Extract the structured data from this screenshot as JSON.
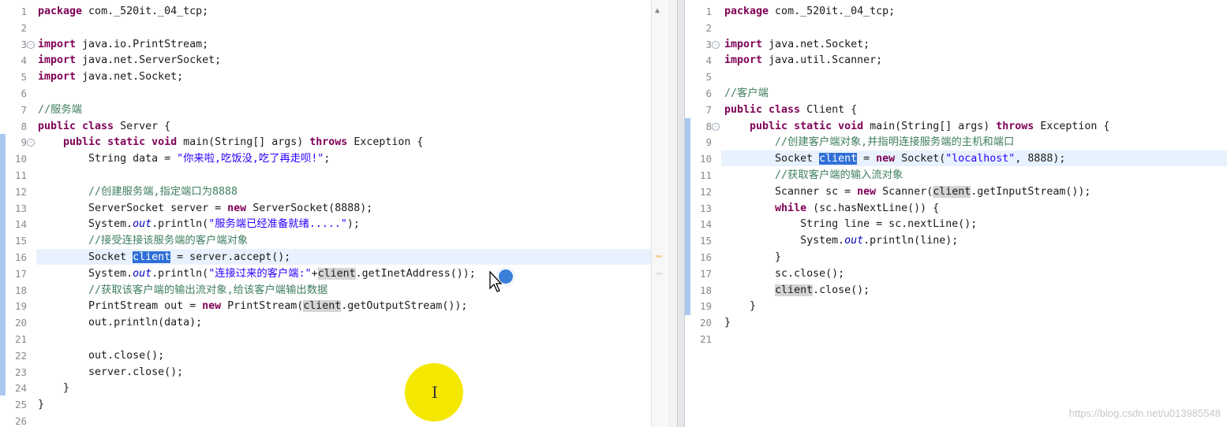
{
  "left_editor": {
    "lines": [
      {
        "n": "1"
      },
      {
        "n": "2"
      },
      {
        "n": "3"
      },
      {
        "n": "4"
      },
      {
        "n": "5"
      },
      {
        "n": "6"
      },
      {
        "n": "7"
      },
      {
        "n": "8"
      },
      {
        "n": "9"
      },
      {
        "n": "10"
      },
      {
        "n": "11"
      },
      {
        "n": "12"
      },
      {
        "n": "13"
      },
      {
        "n": "14"
      },
      {
        "n": "15"
      },
      {
        "n": "16"
      },
      {
        "n": "17"
      },
      {
        "n": "18"
      },
      {
        "n": "19"
      },
      {
        "n": "20"
      },
      {
        "n": "21"
      },
      {
        "n": "22"
      },
      {
        "n": "23"
      },
      {
        "n": "24"
      },
      {
        "n": "25"
      },
      {
        "n": "26"
      }
    ],
    "code": {
      "l1_kw": "package",
      "l1_rest": " com._520it._04_tcp;",
      "l3_kw": "import",
      "l3_rest": " java.io.PrintStream;",
      "l4_kw": "import",
      "l4_rest": " java.net.ServerSocket;",
      "l5_kw": "import",
      "l5_rest": " java.net.Socket;",
      "l7_cmt": "//服务端",
      "l8_kw": "public class",
      "l8_rest": " Server {",
      "l9_indent": "    ",
      "l9_kw": "public static void",
      "l9_mid": " main(String[] args) ",
      "l9_kw2": "throws",
      "l9_rest": " Exception {",
      "l10_pre": "        String data = ",
      "l10_str": "\"你来啦,吃饭没,吃了再走呗!\"",
      "l10_post": ";",
      "l12_cmt": "        //创建服务端,指定端口为8888",
      "l13_pre": "        ServerSocket server = ",
      "l13_kw": "new",
      "l13_post": " ServerSocket(8888);",
      "l14_pre": "        System.",
      "l14_fld": "out",
      "l14_mid": ".println(",
      "l14_str": "\"服务端已经准备就绪.....\"",
      "l14_post": ");",
      "l15_cmt": "        //接受连接该服务端的客户端对象",
      "l16_pre": "        Socket ",
      "l16_sel": "client",
      "l16_post": " = server.accept();",
      "l17_pre": "        System.",
      "l17_fld": "out",
      "l17_mid": ".println(",
      "l17_str": "\"连接过来的客户端:\"",
      "l17_plus": "+",
      "l17_occ": "client",
      "l17_post": ".getInetAddress());",
      "l18_cmt": "        //获取该客户端的输出流对象,给该客户端输出数据",
      "l19_pre": "        PrintStream out = ",
      "l19_kw": "new",
      "l19_mid": " PrintStream(",
      "l19_occ": "client",
      "l19_post": ".getOutputStream());",
      "l20": "        out.println(data);",
      "l22": "        out.close();",
      "l23": "        server.close();",
      "l24": "    }",
      "l25": "}"
    }
  },
  "right_editor": {
    "lines": [
      {
        "n": "1"
      },
      {
        "n": "2"
      },
      {
        "n": "3"
      },
      {
        "n": "4"
      },
      {
        "n": "5"
      },
      {
        "n": "6"
      },
      {
        "n": "7"
      },
      {
        "n": "8"
      },
      {
        "n": "9"
      },
      {
        "n": "10"
      },
      {
        "n": "11"
      },
      {
        "n": "12"
      },
      {
        "n": "13"
      },
      {
        "n": "14"
      },
      {
        "n": "15"
      },
      {
        "n": "16"
      },
      {
        "n": "17"
      },
      {
        "n": "18"
      },
      {
        "n": "19"
      },
      {
        "n": "20"
      },
      {
        "n": "21"
      }
    ],
    "code": {
      "r1_kw": "package",
      "r1_rest": " com._520it._04_tcp;",
      "r3_kw": "import",
      "r3_rest": " java.net.Socket;",
      "r4_kw": "import",
      "r4_rest": " java.util.Scanner;",
      "r6_cmt": "//客户端",
      "r7_kw": "public class",
      "r7_rest": " Client {",
      "r8_indent": "    ",
      "r8_kw": "public static void",
      "r8_mid": " main(String[] args) ",
      "r8_kw2": "throws",
      "r8_rest": " Exception {",
      "r9_cmt": "        //创建客户端对象,并指明连接服务端的主机和端口",
      "r10_pre": "        Socket ",
      "r10_sel": "client",
      "r10_mid": " = ",
      "r10_kw": "new",
      "r10_mid2": " Socket(",
      "r10_str": "\"localhost\"",
      "r10_post": ", 8888);",
      "r11_cmt": "        //获取客户端的输入流对象",
      "r12_pre": "        Scanner sc = ",
      "r12_kw": "new",
      "r12_mid": " Scanner(",
      "r12_occ": "client",
      "r12_post": ".getInputStream());",
      "r13_pre": "        ",
      "r13_kw": "while",
      "r13_post": " (sc.hasNextLine()) {",
      "r14_pre": "            String line = sc.nextLine();",
      "r15_pre": "            System.",
      "r15_fld": "out",
      "r15_post": ".println(line);",
      "r16": "        }",
      "r17": "        sc.close();",
      "r18_pre": "        ",
      "r18_occ": "client",
      "r18_post": ".close();",
      "r19": "    }",
      "r20": "}"
    }
  },
  "watermark": "https://blog.csdn.net/u013985548",
  "colors": {
    "keyword": "#7f0055",
    "string": "#2a00ff",
    "comment": "#3f7f5f",
    "field": "#0000c0",
    "selected_occurrence": "#2f6fd8",
    "occurrence": "#d4d4d4",
    "current_line": "#e8f2fe",
    "change_bar": "#a9c7ef",
    "cursor_highlight": "#f5e800"
  },
  "icons": [
    "fold-collapse-icon",
    "scroll-up-arrow-icon",
    "mouse-pointer-icon",
    "text-cursor-icon"
  ]
}
